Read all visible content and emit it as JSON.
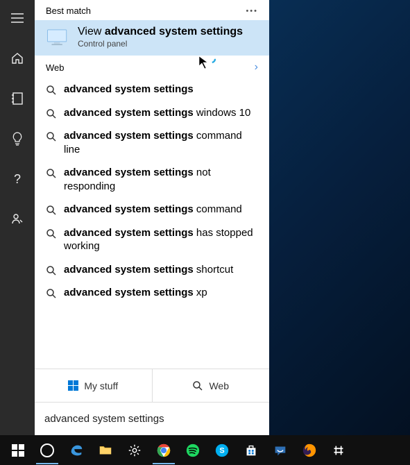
{
  "sidebar": {
    "items": [
      {
        "name": "hamburger-icon"
      },
      {
        "name": "home-icon"
      },
      {
        "name": "notebook-icon"
      },
      {
        "name": "lightbulb-icon"
      },
      {
        "name": "help-icon"
      },
      {
        "name": "feedback-icon"
      }
    ]
  },
  "bestMatch": {
    "header": "Best match",
    "title_prefix": "View ",
    "title_bold": "advanced system settings",
    "subtitle": "Control panel"
  },
  "web": {
    "header": "Web",
    "items": [
      {
        "bold": "advanced system settings",
        "rest": ""
      },
      {
        "bold": "advanced system settings",
        "rest": " windows 10"
      },
      {
        "bold": "advanced system settings",
        "rest": " command line"
      },
      {
        "bold": "advanced system settings",
        "rest": " not responding"
      },
      {
        "bold": "advanced system settings",
        "rest": " command"
      },
      {
        "bold": "advanced system settings",
        "rest": " has stopped working"
      },
      {
        "bold": "advanced system settings",
        "rest": " shortcut"
      },
      {
        "bold": "advanced system settings",
        "rest": " xp"
      }
    ]
  },
  "scopes": {
    "mystuff": "My stuff",
    "web": "Web"
  },
  "searchBox": {
    "value": "advanced system settings"
  },
  "taskbar": {
    "items": [
      {
        "name": "start-button"
      },
      {
        "name": "cortana-button"
      },
      {
        "name": "edge-button"
      },
      {
        "name": "file-explorer-button"
      },
      {
        "name": "settings-button"
      },
      {
        "name": "chrome-button"
      },
      {
        "name": "spotify-button"
      },
      {
        "name": "skype-button"
      },
      {
        "name": "store-button"
      },
      {
        "name": "hipchat-button"
      },
      {
        "name": "firefox-button"
      },
      {
        "name": "slack-button"
      }
    ]
  }
}
